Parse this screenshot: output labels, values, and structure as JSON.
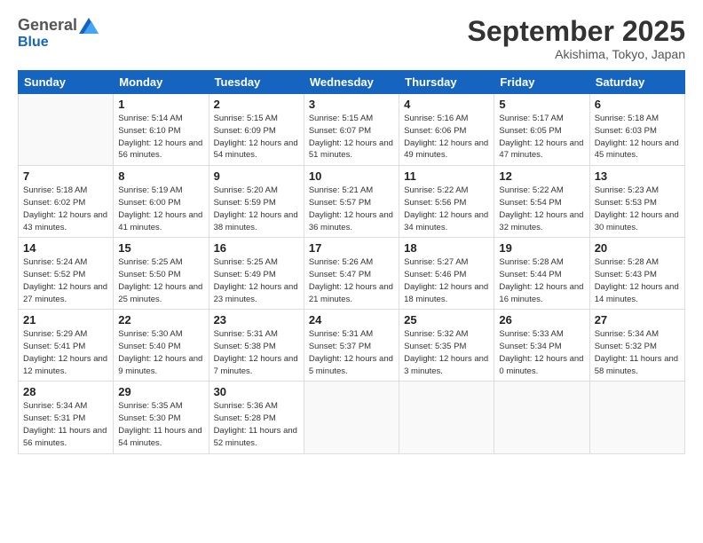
{
  "logo": {
    "general": "General",
    "blue": "Blue"
  },
  "title": "September 2025",
  "location": "Akishima, Tokyo, Japan",
  "days_header": [
    "Sunday",
    "Monday",
    "Tuesday",
    "Wednesday",
    "Thursday",
    "Friday",
    "Saturday"
  ],
  "weeks": [
    [
      {
        "num": "",
        "info": ""
      },
      {
        "num": "1",
        "info": "Sunrise: 5:14 AM\nSunset: 6:10 PM\nDaylight: 12 hours\nand 56 minutes."
      },
      {
        "num": "2",
        "info": "Sunrise: 5:15 AM\nSunset: 6:09 PM\nDaylight: 12 hours\nand 54 minutes."
      },
      {
        "num": "3",
        "info": "Sunrise: 5:15 AM\nSunset: 6:07 PM\nDaylight: 12 hours\nand 51 minutes."
      },
      {
        "num": "4",
        "info": "Sunrise: 5:16 AM\nSunset: 6:06 PM\nDaylight: 12 hours\nand 49 minutes."
      },
      {
        "num": "5",
        "info": "Sunrise: 5:17 AM\nSunset: 6:05 PM\nDaylight: 12 hours\nand 47 minutes."
      },
      {
        "num": "6",
        "info": "Sunrise: 5:18 AM\nSunset: 6:03 PM\nDaylight: 12 hours\nand 45 minutes."
      }
    ],
    [
      {
        "num": "7",
        "info": "Sunrise: 5:18 AM\nSunset: 6:02 PM\nDaylight: 12 hours\nand 43 minutes."
      },
      {
        "num": "8",
        "info": "Sunrise: 5:19 AM\nSunset: 6:00 PM\nDaylight: 12 hours\nand 41 minutes."
      },
      {
        "num": "9",
        "info": "Sunrise: 5:20 AM\nSunset: 5:59 PM\nDaylight: 12 hours\nand 38 minutes."
      },
      {
        "num": "10",
        "info": "Sunrise: 5:21 AM\nSunset: 5:57 PM\nDaylight: 12 hours\nand 36 minutes."
      },
      {
        "num": "11",
        "info": "Sunrise: 5:22 AM\nSunset: 5:56 PM\nDaylight: 12 hours\nand 34 minutes."
      },
      {
        "num": "12",
        "info": "Sunrise: 5:22 AM\nSunset: 5:54 PM\nDaylight: 12 hours\nand 32 minutes."
      },
      {
        "num": "13",
        "info": "Sunrise: 5:23 AM\nSunset: 5:53 PM\nDaylight: 12 hours\nand 30 minutes."
      }
    ],
    [
      {
        "num": "14",
        "info": "Sunrise: 5:24 AM\nSunset: 5:52 PM\nDaylight: 12 hours\nand 27 minutes."
      },
      {
        "num": "15",
        "info": "Sunrise: 5:25 AM\nSunset: 5:50 PM\nDaylight: 12 hours\nand 25 minutes."
      },
      {
        "num": "16",
        "info": "Sunrise: 5:25 AM\nSunset: 5:49 PM\nDaylight: 12 hours\nand 23 minutes."
      },
      {
        "num": "17",
        "info": "Sunrise: 5:26 AM\nSunset: 5:47 PM\nDaylight: 12 hours\nand 21 minutes."
      },
      {
        "num": "18",
        "info": "Sunrise: 5:27 AM\nSunset: 5:46 PM\nDaylight: 12 hours\nand 18 minutes."
      },
      {
        "num": "19",
        "info": "Sunrise: 5:28 AM\nSunset: 5:44 PM\nDaylight: 12 hours\nand 16 minutes."
      },
      {
        "num": "20",
        "info": "Sunrise: 5:28 AM\nSunset: 5:43 PM\nDaylight: 12 hours\nand 14 minutes."
      }
    ],
    [
      {
        "num": "21",
        "info": "Sunrise: 5:29 AM\nSunset: 5:41 PM\nDaylight: 12 hours\nand 12 minutes."
      },
      {
        "num": "22",
        "info": "Sunrise: 5:30 AM\nSunset: 5:40 PM\nDaylight: 12 hours\nand 9 minutes."
      },
      {
        "num": "23",
        "info": "Sunrise: 5:31 AM\nSunset: 5:38 PM\nDaylight: 12 hours\nand 7 minutes."
      },
      {
        "num": "24",
        "info": "Sunrise: 5:31 AM\nSunset: 5:37 PM\nDaylight: 12 hours\nand 5 minutes."
      },
      {
        "num": "25",
        "info": "Sunrise: 5:32 AM\nSunset: 5:35 PM\nDaylight: 12 hours\nand 3 minutes."
      },
      {
        "num": "26",
        "info": "Sunrise: 5:33 AM\nSunset: 5:34 PM\nDaylight: 12 hours\nand 0 minutes."
      },
      {
        "num": "27",
        "info": "Sunrise: 5:34 AM\nSunset: 5:32 PM\nDaylight: 11 hours\nand 58 minutes."
      }
    ],
    [
      {
        "num": "28",
        "info": "Sunrise: 5:34 AM\nSunset: 5:31 PM\nDaylight: 11 hours\nand 56 minutes."
      },
      {
        "num": "29",
        "info": "Sunrise: 5:35 AM\nSunset: 5:30 PM\nDaylight: 11 hours\nand 54 minutes."
      },
      {
        "num": "30",
        "info": "Sunrise: 5:36 AM\nSunset: 5:28 PM\nDaylight: 11 hours\nand 52 minutes."
      },
      {
        "num": "",
        "info": ""
      },
      {
        "num": "",
        "info": ""
      },
      {
        "num": "",
        "info": ""
      },
      {
        "num": "",
        "info": ""
      }
    ]
  ]
}
